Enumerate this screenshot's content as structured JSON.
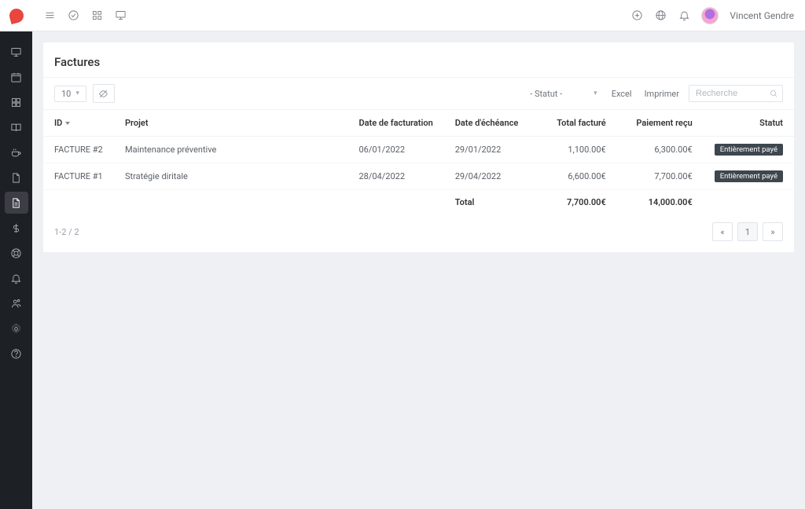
{
  "user": {
    "name": "Vincent Gendre"
  },
  "page": {
    "title": "Factures"
  },
  "toolbar": {
    "page_size": "10",
    "status_label": "- Statut -",
    "excel": "Excel",
    "print": "Imprimer",
    "search_placeholder": "Recherche"
  },
  "table": {
    "headers": {
      "id": "ID",
      "projet": "Projet",
      "date_fact": "Date de facturation",
      "date_eche": "Date d'échéance",
      "total_facture": "Total facturé",
      "paiement": "Paiement reçu",
      "statut": "Statut"
    },
    "rows": [
      {
        "id": "FACTURE #2",
        "projet": "Maintenance préventive",
        "date_fact": "06/01/2022",
        "date_eche": "29/01/2022",
        "total_facture": "1,100.00€",
        "paiement": "6,300.00€",
        "statut": "Entièrement payé"
      },
      {
        "id": "FACTURE #1",
        "projet": "Stratégie diritale",
        "date_fact": "28/04/2022",
        "date_eche": "29/04/2022",
        "total_facture": "6,600.00€",
        "paiement": "7,700.00€",
        "statut": "Entièrement payé"
      }
    ],
    "footer": {
      "label": "Total",
      "total_facture": "7,700.00€",
      "paiement": "14,000.00€"
    }
  },
  "footer": {
    "range": "1-2 / 2",
    "current_page": "1"
  }
}
